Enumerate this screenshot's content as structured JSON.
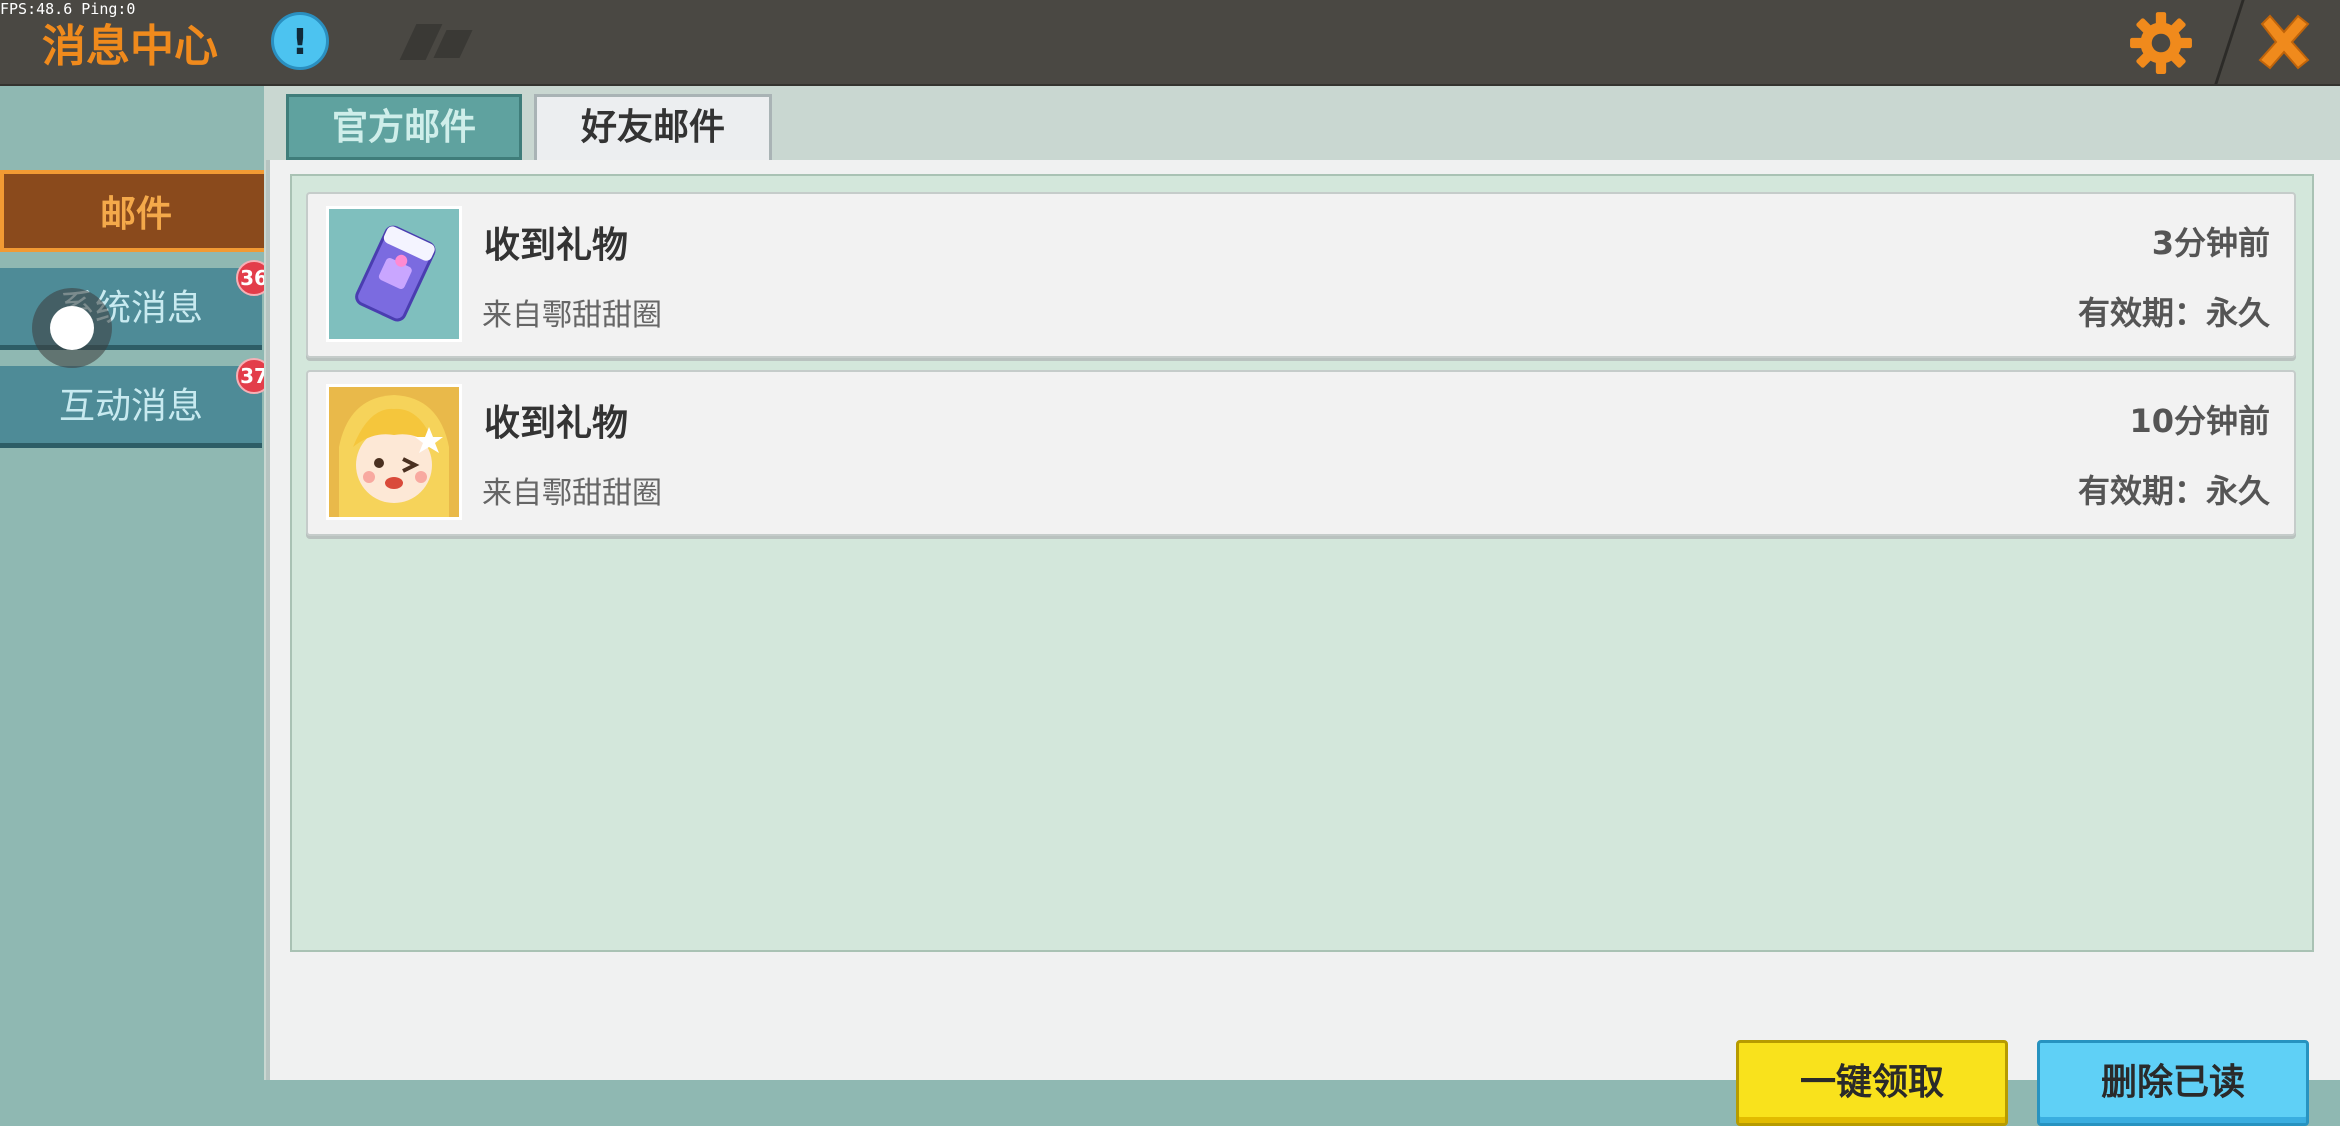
{
  "debug": {
    "fps_text": "FPS:48.6  Ping:0"
  },
  "header": {
    "title": "消息中心",
    "info_label": "!",
    "settings_icon": "gear-icon",
    "close_icon": "close-icon",
    "accent_color": "#f08a1c"
  },
  "sidebar": {
    "items": [
      {
        "label": "邮件",
        "active": true
      },
      {
        "label": "系统消息",
        "badge": "36"
      },
      {
        "label": "互动消息",
        "badge": "37"
      }
    ]
  },
  "tabs": [
    {
      "label": "官方邮件",
      "active": false
    },
    {
      "label": "好友邮件",
      "active": true
    }
  ],
  "mails": [
    {
      "title": "收到礼物",
      "sender": "来自鄠甜甜圈",
      "time": "3分钟前",
      "expire": "有效期：永久",
      "icon": "gift-card-icon"
    },
    {
      "title": "收到礼物",
      "sender": "来自鄠甜甜圈",
      "time": "10分钟前",
      "expire": "有效期：永久",
      "icon": "avatar-icon"
    }
  ],
  "actions": {
    "claim_all": "一键领取",
    "delete_read": "删除已读"
  }
}
